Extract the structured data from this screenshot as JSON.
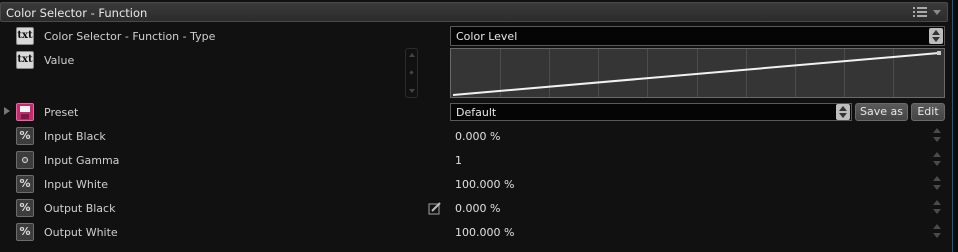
{
  "header": {
    "title": "Color Selector - Function"
  },
  "rows": {
    "type": {
      "label": "Color Selector - Function - Type",
      "icon": "txt-icon",
      "value": "Color Level"
    },
    "value": {
      "label": "Value",
      "icon": "txt-icon"
    },
    "preset": {
      "label": "Preset",
      "icon": "preset-icon",
      "value": "Default"
    },
    "input_black": {
      "label": "Input Black",
      "icon": "percent-icon",
      "value": "0.000 %"
    },
    "input_gamma": {
      "label": "Input Gamma",
      "icon": "gamma-icon",
      "value": "1"
    },
    "input_white": {
      "label": "Input White",
      "icon": "percent-icon",
      "value": "100.000 %"
    },
    "output_black": {
      "label": "Output Black",
      "icon": "percent-icon",
      "value": "0.000 %"
    },
    "output_white": {
      "label": "Output White",
      "icon": "percent-icon",
      "value": "100.000 %"
    }
  },
  "icon_text": {
    "txt": "txt",
    "percent": "%"
  },
  "buttons": {
    "save_as": "Save as",
    "edit": "Edit"
  },
  "curve": {
    "start": [
      0,
      0
    ],
    "end": [
      1,
      1
    ]
  },
  "colors": {
    "accent_edge": "#1e5a8a",
    "preset_icon": "#c42b6e",
    "curve_bg": "#353535"
  }
}
